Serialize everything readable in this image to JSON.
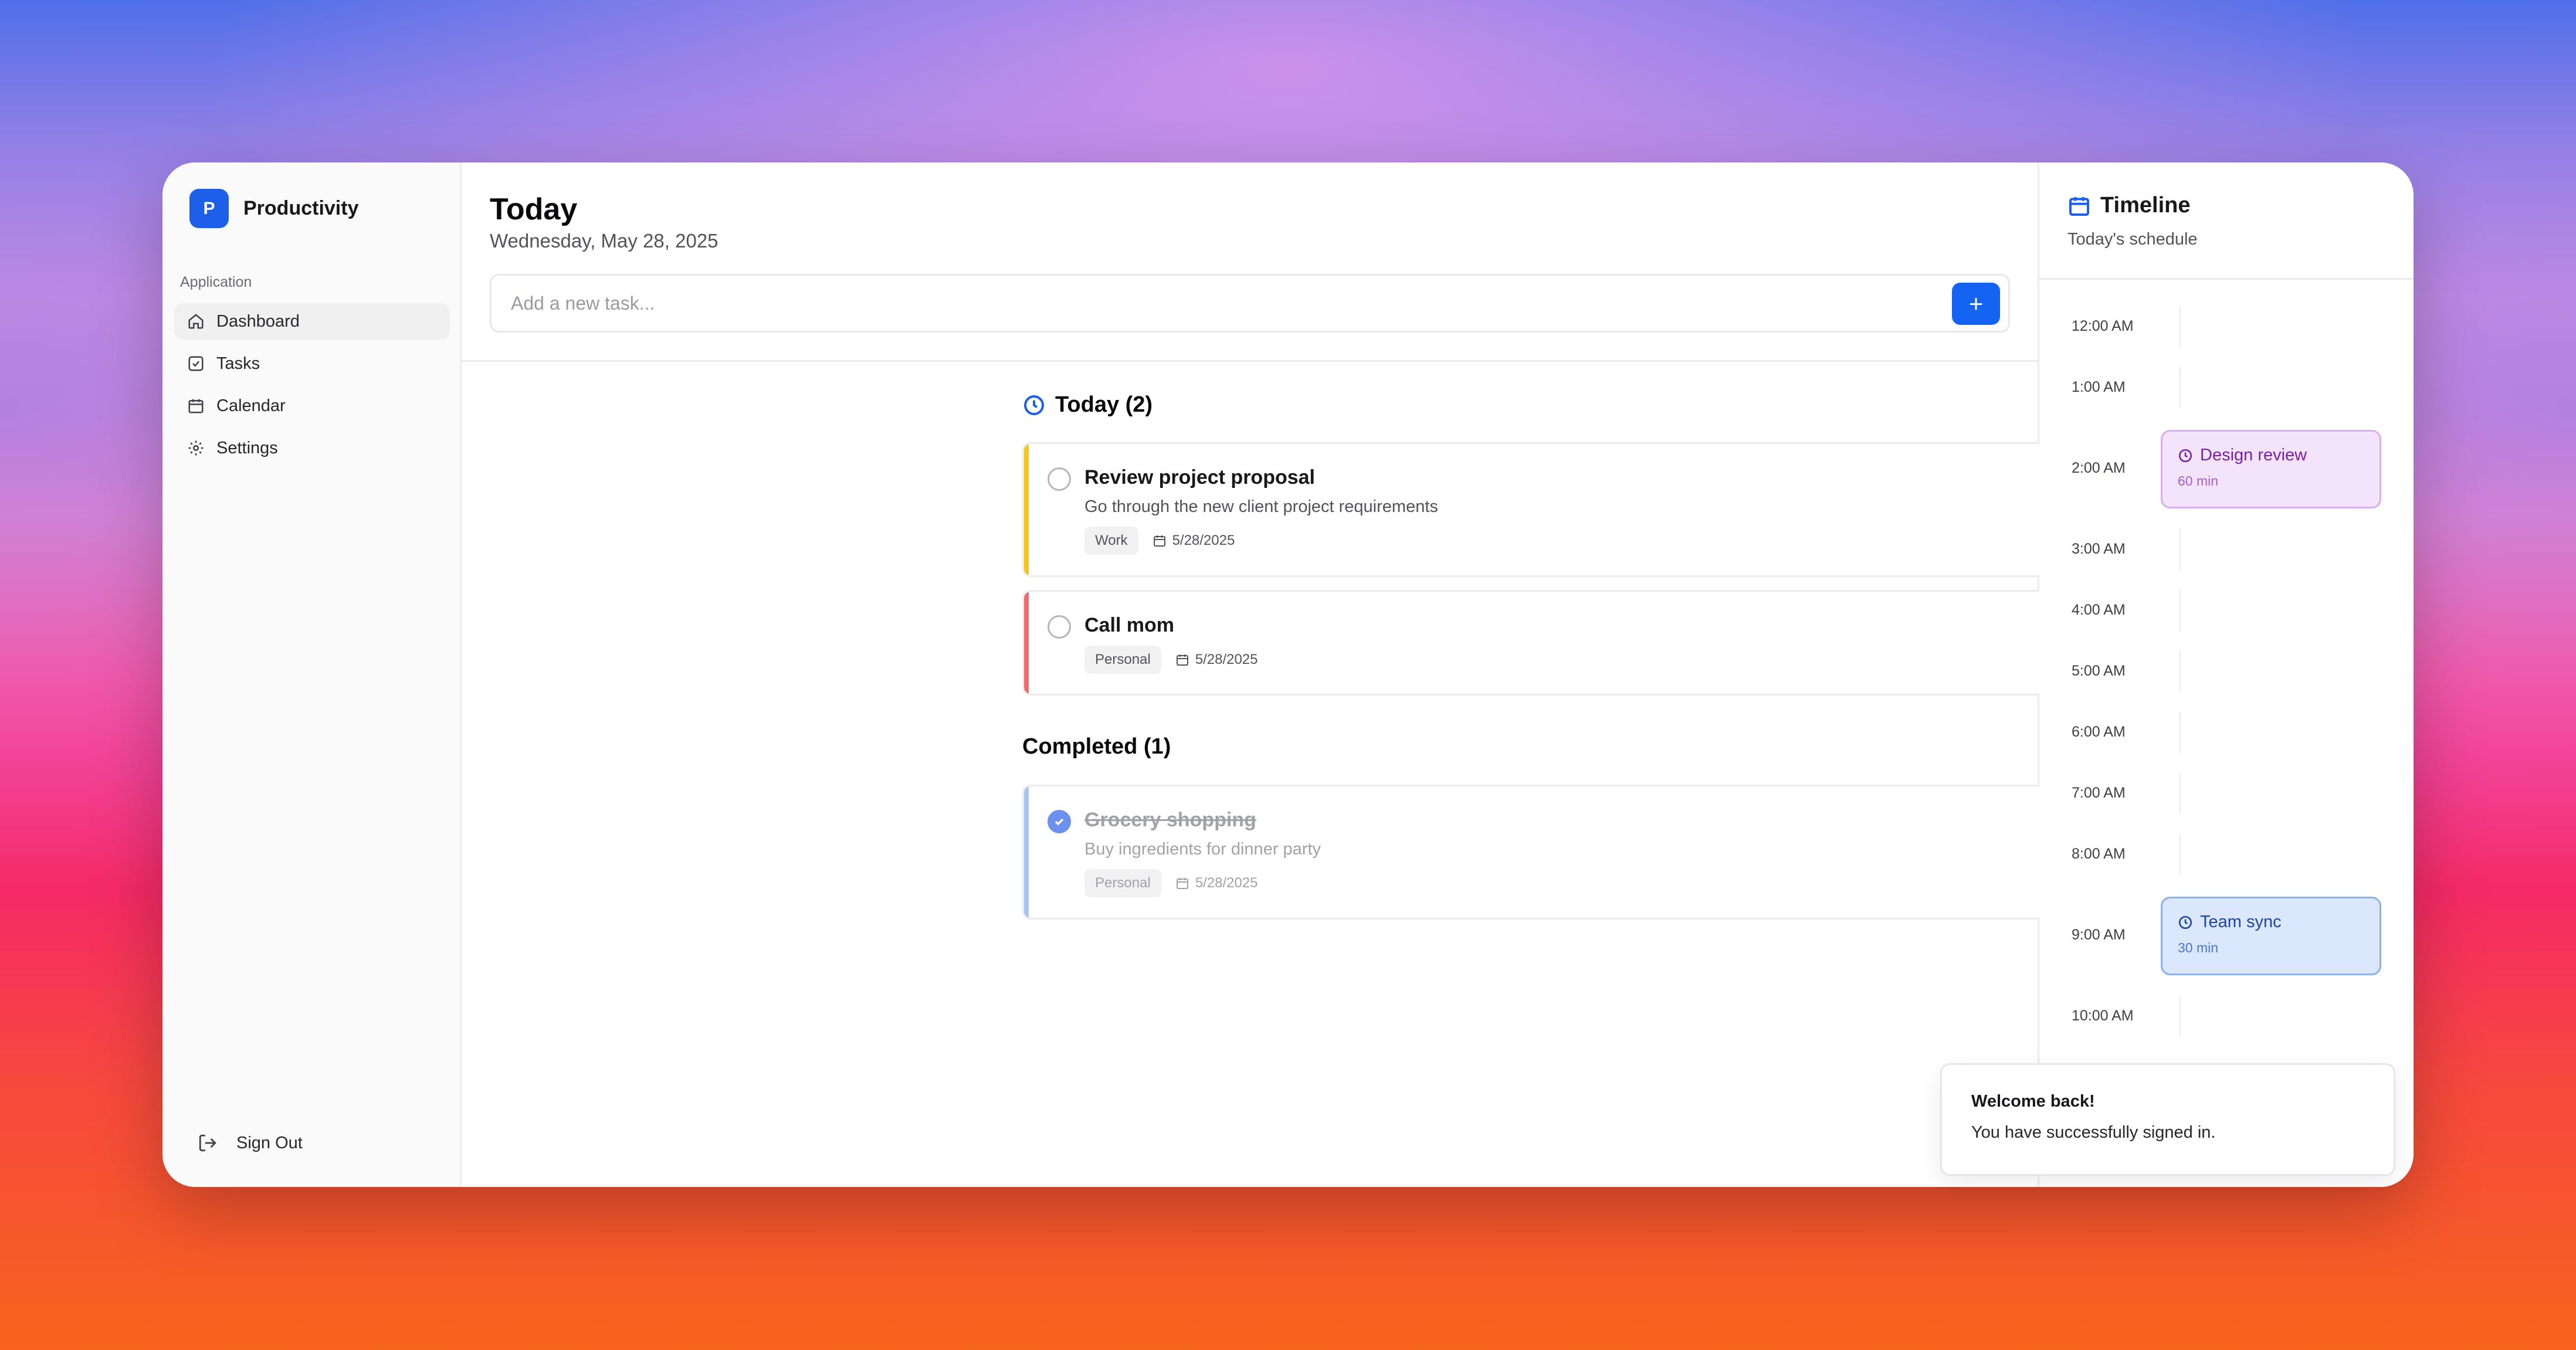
{
  "sidebar": {
    "brand_initial": "P",
    "brand_name": "Productivity",
    "section_label": "Application",
    "items": [
      {
        "label": "Dashboard",
        "icon": "home-icon",
        "active": true
      },
      {
        "label": "Tasks",
        "icon": "check-square-icon"
      },
      {
        "label": "Calendar",
        "icon": "calendar-icon"
      },
      {
        "label": "Settings",
        "icon": "gear-icon"
      }
    ],
    "sign_out": "Sign Out"
  },
  "main": {
    "title": "Today",
    "date": "Wednesday, May 28, 2025",
    "add_placeholder": "Add a new task...",
    "add_button": "+",
    "today_group": {
      "label": "Today (2)",
      "tasks": [
        {
          "title": "Review project proposal",
          "description": "Go through the new client project requirements",
          "tag": "Work",
          "date": "5/28/2025",
          "accent": "#f5c518"
        },
        {
          "title": "Call mom",
          "tag": "Personal",
          "date": "5/28/2025",
          "accent": "#ef6b6b"
        }
      ]
    },
    "completed_group": {
      "label": "Completed (1)",
      "tasks": [
        {
          "title": "Grocery shopping",
          "description": "Buy ingredients for dinner party",
          "tag": "Personal",
          "date": "5/28/2025",
          "accent": "#a9c3f2",
          "done": true
        }
      ]
    }
  },
  "timeline": {
    "title": "Timeline",
    "subtitle": "Today's schedule",
    "hours": [
      "12:00 AM",
      "1:00 AM",
      "2:00 AM",
      "3:00 AM",
      "4:00 AM",
      "5:00 AM",
      "6:00 AM",
      "7:00 AM",
      "8:00 AM",
      "9:00 AM",
      "10:00 AM"
    ],
    "events": [
      {
        "title": "Design review",
        "duration": "60 min",
        "hour": "2:00 AM",
        "color": "purple"
      },
      {
        "title": "Team sync",
        "duration": "30 min",
        "hour": "9:00 AM",
        "color": "blue"
      }
    ]
  },
  "toast": {
    "title": "Welcome back!",
    "message": "You have successfully signed in."
  },
  "colors": {
    "primary": "#1463f3",
    "work_accent": "#f5c518",
    "personal_accent": "#ef6b6b",
    "completed_accent": "#a9c3f2"
  }
}
